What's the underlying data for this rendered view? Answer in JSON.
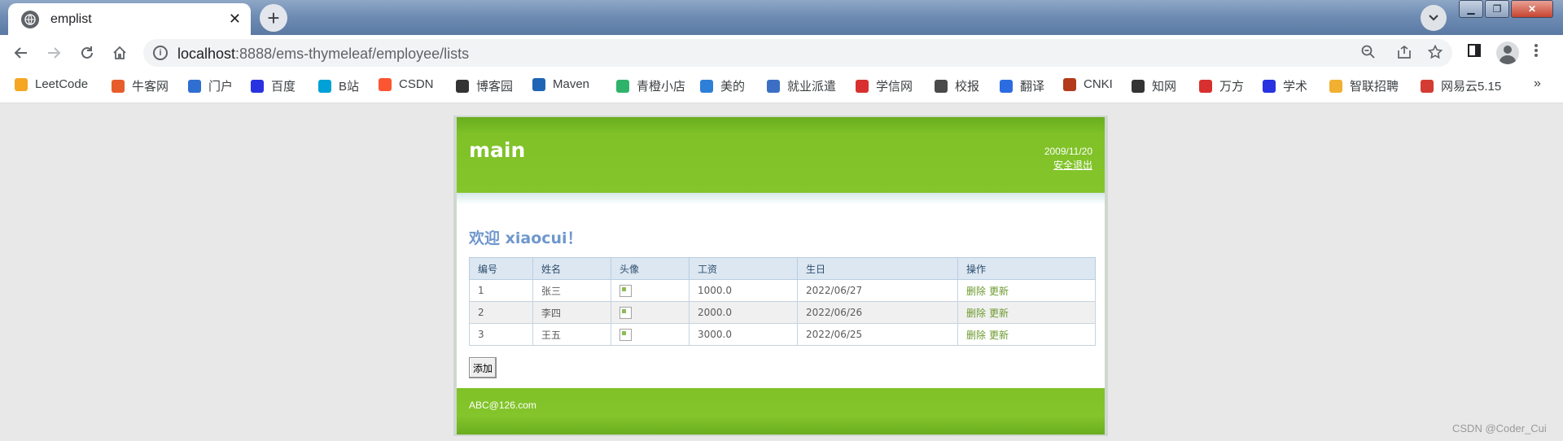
{
  "browser": {
    "tab_title": "emplist",
    "url_host": "localhost",
    "url_rest": ":8888/ems-thymeleaf/employee/lists",
    "bookmarks": [
      "LeetCode",
      "牛客网",
      "门户",
      "百度",
      "B站",
      "CSDN",
      "博客园",
      "Maven",
      "青橙小店",
      "美的",
      "就业派遣",
      "学信网",
      "校报",
      "翻译",
      "CNKI",
      "知网",
      "万方",
      "学术",
      "智联招聘",
      "网易云5.15"
    ],
    "bookmark_colors": [
      "#f5a623",
      "#e65c2a",
      "#2f6fd1",
      "#2932e1",
      "#00a1d6",
      "#fc5531",
      "#333333",
      "#1f65b5",
      "#2fb36a",
      "#2e7fd7",
      "#3c6fc4",
      "#d8302e",
      "#4a4a4a",
      "#2b6ce0",
      "#b33a1a",
      "#333333",
      "#d8302e",
      "#2932e1",
      "#f1b032",
      "#d43c33"
    ]
  },
  "page": {
    "brand": "main",
    "date": "2009/11/20",
    "logout": "安全退出",
    "welcome": "欢迎 xiaocui！",
    "table": {
      "headers": [
        "编号",
        "姓名",
        "头像",
        "工资",
        "生日",
        "操作"
      ],
      "rows": [
        {
          "id": "1",
          "name": "张三",
          "salary": "1000.0",
          "birthday": "2022/06/27"
        },
        {
          "id": "2",
          "name": "李四",
          "salary": "2000.0",
          "birthday": "2022/06/26"
        },
        {
          "id": "3",
          "name": "王五",
          "salary": "3000.0",
          "birthday": "2022/06/25"
        }
      ],
      "delete_label": "删除",
      "update_label": "更新"
    },
    "add_label": "添加",
    "footer": "ABC@126.com"
  },
  "watermark": "CSDN @Coder_Cui",
  "colors": {
    "header_green": "#84c52c",
    "link_green": "#6c9a2e",
    "welcome_blue": "#6f97cc"
  }
}
